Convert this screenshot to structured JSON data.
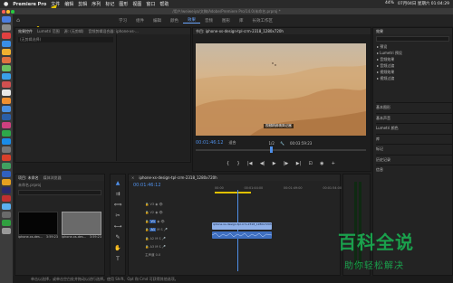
{
  "menubar": {
    "apple": "",
    "app": "Premiere Pro",
    "items": [
      "文件",
      "编辑",
      "剪辑",
      "序列",
      "标记",
      "图形",
      "视图",
      "窗口",
      "帮助"
    ],
    "right_status": "07月04日 星期六 01:04:29",
    "battery": "44%"
  },
  "titlebar": {
    "text": "/用户/weiweiya/文稿/Adobe/Premiere Pro/14.0/未命名.prproj *"
  },
  "workspace": {
    "tabs": [
      "学习",
      "组件",
      "编辑",
      "颜色",
      "效果",
      "音频",
      "图形",
      "库",
      "长效工作区"
    ],
    "active": "效果"
  },
  "source_panel": {
    "tabs": [
      "效果控件",
      "Lumetri 范围",
      "源: (无剪辑)",
      "音频剪辑混合器: iphone-xs-..."
    ],
    "empty_text": "(无剪辑选择)"
  },
  "program_monitor": {
    "title": "节目: iphone-xs-design-tpl-crm-2318_1280x720h",
    "subtitle": "视频精辟精简记器",
    "timecode_left": "00:01:46:12",
    "fit": "适合",
    "ratio": "1/2",
    "timecode_right": "00:03:59:23"
  },
  "effects_panel": {
    "title": "效果",
    "search_placeholder": "",
    "items": [
      "预设",
      "Lumetri 预设",
      "音频效果",
      "音频过渡",
      "视频效果",
      "视频过渡"
    ],
    "sections": [
      "基本图形",
      "基本声音",
      "Lumetri 颜色",
      "库",
      "标记",
      "历史记录",
      "信息"
    ]
  },
  "project_panel": {
    "tabs": [
      "项目: 未命名",
      "媒体浏览器"
    ],
    "project_file": "未命名.prproj",
    "clips": [
      {
        "name": "iphone-xs-des...",
        "duration": "3:59:23"
      },
      {
        "name": "iphone-xs-des...",
        "duration": "3:59:23"
      }
    ]
  },
  "timeline": {
    "title": "iphone-xs-design-tpl-crm-2318_1280x720h",
    "timecode": "00:01:46:12",
    "ruler": [
      "00:00",
      "00:01:44:00",
      "00:01:49:00",
      "00:01:54:00"
    ],
    "video_tracks": [
      "V3",
      "V2",
      "V1"
    ],
    "audio_tracks": [
      "A1",
      "A2",
      "A3"
    ],
    "master": "主声道",
    "master_value": "0.0",
    "clip_label": "iphone-xs-design-tpl-crm-2318_1280x720h.mp4 [V]"
  },
  "status_text": "单击以选择，或单击空白处并拖动以进行选择。使用 Shift、Opt 和 Cmd 可获得其他选项。",
  "watermark": {
    "line1": "百科全说",
    "line2": "助你轻松解决"
  },
  "colors": {
    "accent": "#4f8fe8",
    "watermark": "#1aa04c",
    "arrow": "#e0c000"
  }
}
